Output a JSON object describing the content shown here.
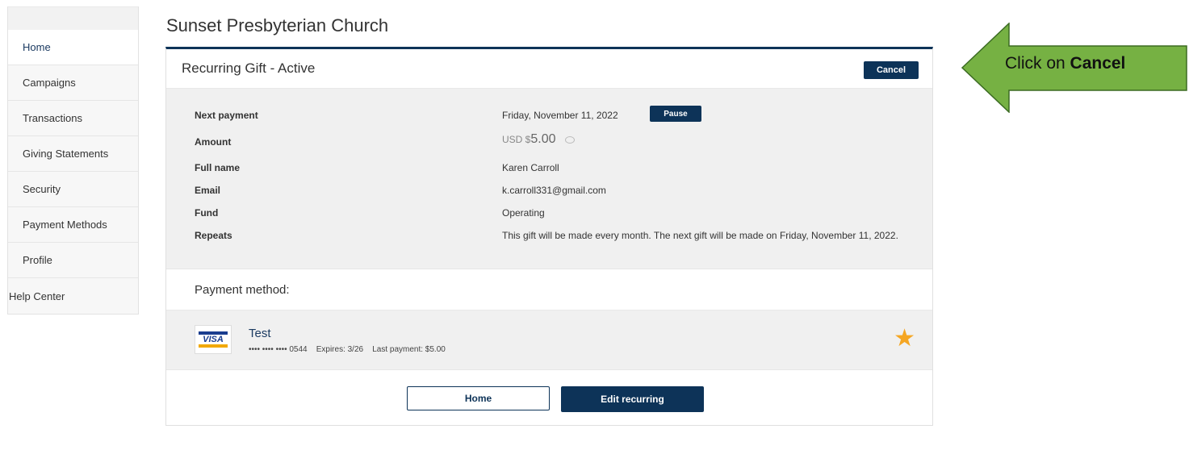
{
  "sidebar": {
    "items": [
      {
        "label": "Home"
      },
      {
        "label": "Campaigns"
      },
      {
        "label": "Transactions"
      },
      {
        "label": "Giving Statements"
      },
      {
        "label": "Security"
      },
      {
        "label": "Payment Methods"
      },
      {
        "label": "Profile"
      },
      {
        "label": "Help Center"
      }
    ]
  },
  "page": {
    "church_name": "Sunset Presbyterian Church"
  },
  "card": {
    "title": "Recurring Gift - Active",
    "cancel_label": "Cancel",
    "details": {
      "next_payment_label": "Next payment",
      "next_payment_value": "Friday, November 11, 2022",
      "pause_label": "Pause",
      "amount_label": "Amount",
      "amount_currency": "USD $",
      "amount_value": "5.00",
      "full_name_label": "Full name",
      "full_name_value": "Karen Carroll",
      "email_label": "Email",
      "email_value": "k.carroll331@gmail.com",
      "fund_label": "Fund",
      "fund_value": "Operating",
      "repeats_label": "Repeats",
      "repeats_value": "This gift will be made every month. The next gift will be made on Friday, November 11, 2022."
    },
    "payment_method": {
      "heading": "Payment method:",
      "card_brand": "VISA",
      "name": "Test",
      "masked_number": "•••• •••• •••• 0544",
      "expires": "Expires: 3/26",
      "last_payment": "Last payment: $5.00"
    },
    "buttons": {
      "home_label": "Home",
      "edit_label": "Edit recurring"
    }
  },
  "callout": {
    "prefix": "Click on ",
    "bold": "Cancel",
    "color": "#76b143"
  },
  "colors": {
    "primary": "#0d3358",
    "star": "#f5a623"
  },
  "icons": [
    "refresh-icon",
    "star-icon",
    "visa-logo-icon",
    "arrow-callout-icon"
  ]
}
